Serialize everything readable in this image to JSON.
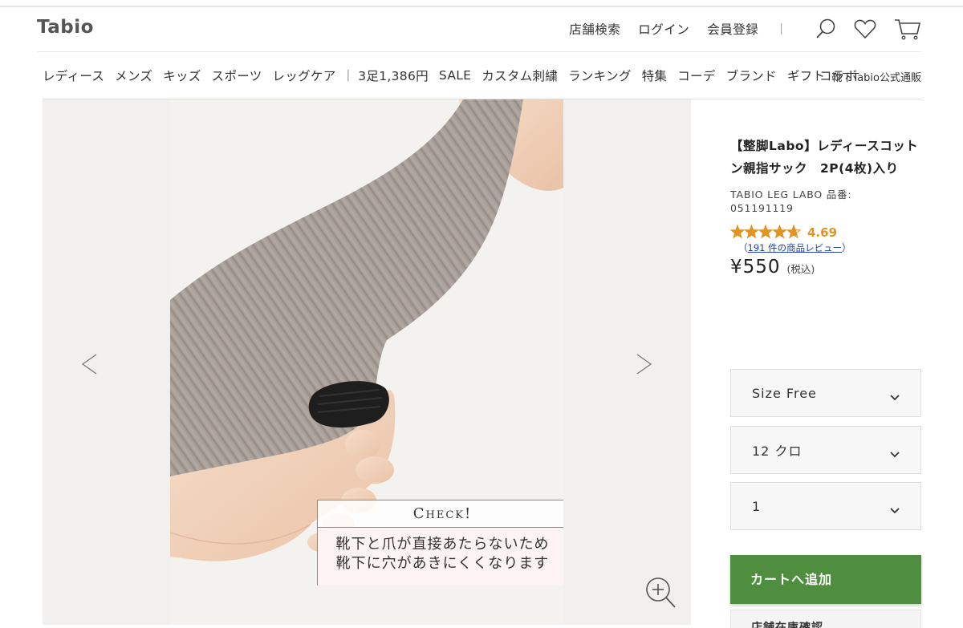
{
  "brand": {
    "logo": "Tabio"
  },
  "header": {
    "links": [
      "店舗検索",
      "ログイン",
      "会員登録"
    ],
    "separator": "|",
    "icons": [
      "search-icon",
      "heart-icon",
      "cart-icon"
    ]
  },
  "nav": {
    "items_left": [
      "レディース",
      "メンズ",
      "キッズ",
      "スポーツ",
      "レッグケア"
    ],
    "separator": "|",
    "items_right": [
      "3足1,386円",
      "SALE",
      "カスタム刺繍",
      "ランキング",
      "特集",
      "コーデ",
      "ブランド",
      "ギフト"
    ],
    "overlap_text": "コラボ",
    "overlap_text2": "靴下Tabio公式通販"
  },
  "gallery": {
    "check_title": "Check!",
    "check_line1": "靴下と爪が直接あたらないため",
    "check_line2": "靴下に穴があきにくくなります"
  },
  "product": {
    "title": "【整脚Labo】レディースコットン親指サック　2P(4枚)入り",
    "brand_line": "TABIO LEG LABO 品番:",
    "code": "051191119",
    "rating": "4.69",
    "rating_stars": 4.69,
    "review_prefix": "（",
    "review_link": "191 件の商品レビュー",
    "review_suffix": "）",
    "price": "¥550",
    "tax": "(税込)"
  },
  "options": {
    "size": "Size Free",
    "color": "12 クロ",
    "quantity": "1"
  },
  "actions": {
    "add_to_cart": "カートへ追加",
    "store_stock": "店舗在庫確認"
  },
  "colors": {
    "cart_green": "#4f8e3f",
    "rating_orange": "#e39321",
    "link_blue": "#2244aa"
  }
}
